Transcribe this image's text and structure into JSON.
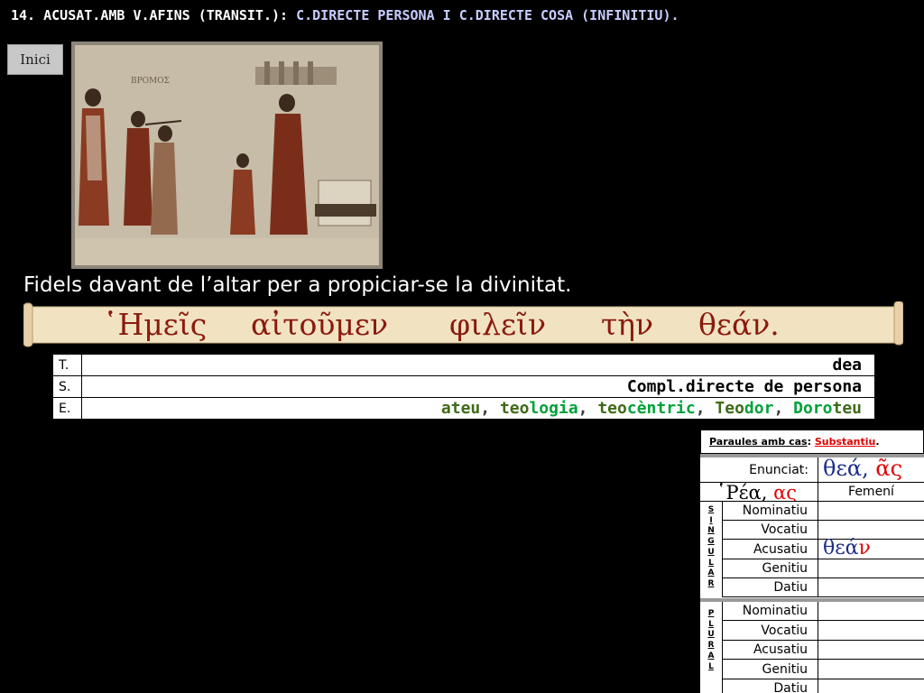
{
  "header": {
    "title_part1": "14. ACUSAT.AMB V.AFINS (TRANSIT.):",
    "title_part2": "C.DIRECTE PERSONA I C.DIRECTE COSA (INFINITIU).",
    "inici_button": "Inici"
  },
  "caption": "Fidels davant de l’altar per a propiciar-se la divinitat.",
  "greek_sentence": {
    "words": [
      "῾Ημεῖς",
      "αἰτοῦμεν",
      "φιλεῖν",
      "τὴν",
      "θεάν."
    ]
  },
  "tse_table": {
    "rows": [
      {
        "label": "T.",
        "value": "dea"
      },
      {
        "label": "S.",
        "value": "Compl.directe de persona"
      },
      {
        "label": "E.",
        "derivatives": [
          {
            "root": "ateu",
            "suffix": ""
          },
          {
            "root": "teo",
            "suffix": "logia"
          },
          {
            "root": "teo",
            "suffix": "cèntric"
          },
          {
            "root": "Teo",
            "suffix": "dor"
          },
          {
            "root": "Doro",
            "suffix": "teu"
          }
        ]
      }
    ]
  },
  "case_panel": {
    "heading_prefix": "Paraules amb cas",
    "heading_colon": ":",
    "heading_type": "Substantiu",
    "heading_end": ".",
    "enunciat_label": "Enunciat:",
    "enunciat_stem": "θεά",
    "enunciat_sep": ", ",
    "enunciat_end": "ᾶς",
    "model_stem": "῾Ρέα",
    "model_sep": ", ",
    "model_end": "ας",
    "gender": "Femení",
    "singular_letters": [
      "S",
      "I",
      "N",
      "G",
      "U",
      "L",
      "A",
      "R"
    ],
    "plural_letters": [
      "P",
      "L",
      "U",
      "R",
      "A",
      "L"
    ],
    "singular": [
      {
        "case": "Nominatiu",
        "stem": "",
        "end": ""
      },
      {
        "case": "Vocatiu",
        "stem": "",
        "end": ""
      },
      {
        "case": "Acusatiu",
        "stem": "θεά",
        "end": "ν"
      },
      {
        "case": "Genitiu",
        "stem": "",
        "end": ""
      },
      {
        "case": "Datiu",
        "stem": "",
        "end": ""
      }
    ],
    "plural": [
      {
        "case": "Nominatiu"
      },
      {
        "case": "Vocatiu"
      },
      {
        "case": "Acusatiu"
      },
      {
        "case": "Genitiu"
      },
      {
        "case": "Datiu"
      }
    ]
  },
  "colors": {
    "title_blue": "#c7ccff",
    "greek_red": "#8a1a0e",
    "navy": "#1b2c8a",
    "pink": "#ee2f93",
    "green": "#00a23a",
    "olive": "#3f6a17",
    "ending_red": "#e00000"
  }
}
